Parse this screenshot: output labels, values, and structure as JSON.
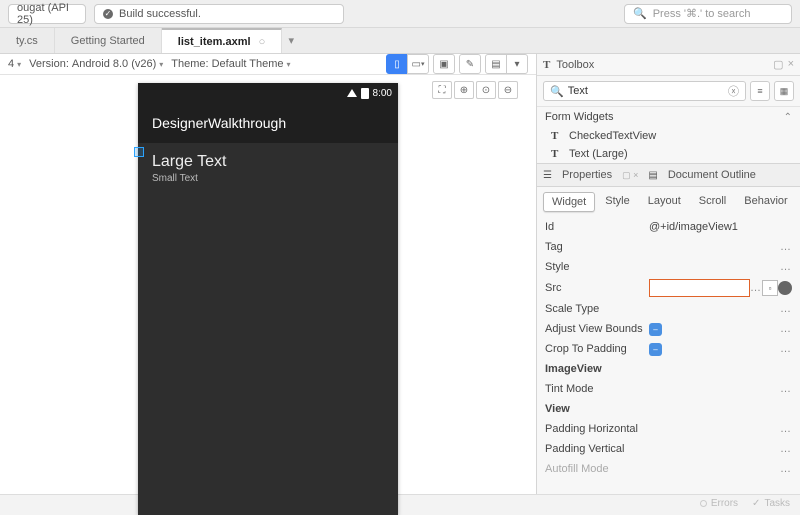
{
  "topbar": {
    "api_label": "ougat (API 25)",
    "build_status": "Build successful.",
    "search_placeholder": "Press '⌘.' to search"
  },
  "tabs": {
    "t0": "ty.cs",
    "t1": "Getting Started",
    "t2": "list_item.axml"
  },
  "designer_bar": {
    "device_value": "4",
    "version_label": "Version:",
    "version_value": "Android 8.0 (v26)",
    "theme_label": "Theme:",
    "theme_value": "Default Theme"
  },
  "phone": {
    "time": "8:00",
    "app_title": "DesignerWalkthrough",
    "large_text": "Large Text",
    "small_text": "Small Text"
  },
  "toolbox": {
    "title": "Toolbox",
    "search_value": "Text",
    "section": "Form Widgets",
    "item0": "CheckedTextView",
    "item1": "Text (Large)"
  },
  "props": {
    "title": "Properties",
    "outline": "Document Outline",
    "tabs": {
      "widget": "Widget",
      "style": "Style",
      "layout": "Layout",
      "scroll": "Scroll",
      "behavior": "Behavior"
    },
    "rows": {
      "id_lbl": "Id",
      "id_val": "@+id/imageView1",
      "tag_lbl": "Tag",
      "style_lbl": "Style",
      "src_lbl": "Src",
      "scale_lbl": "Scale Type",
      "avb_lbl": "Adjust View Bounds",
      "ctp_lbl": "Crop To Padding",
      "imgv": "ImageView",
      "tint_lbl": "Tint Mode",
      "view": "View",
      "ph_lbl": "Padding Horizontal",
      "pv_lbl": "Padding Vertical",
      "af_lbl": "Autofill Mode"
    }
  },
  "status": {
    "errors": "Errors",
    "tasks": "Tasks"
  }
}
